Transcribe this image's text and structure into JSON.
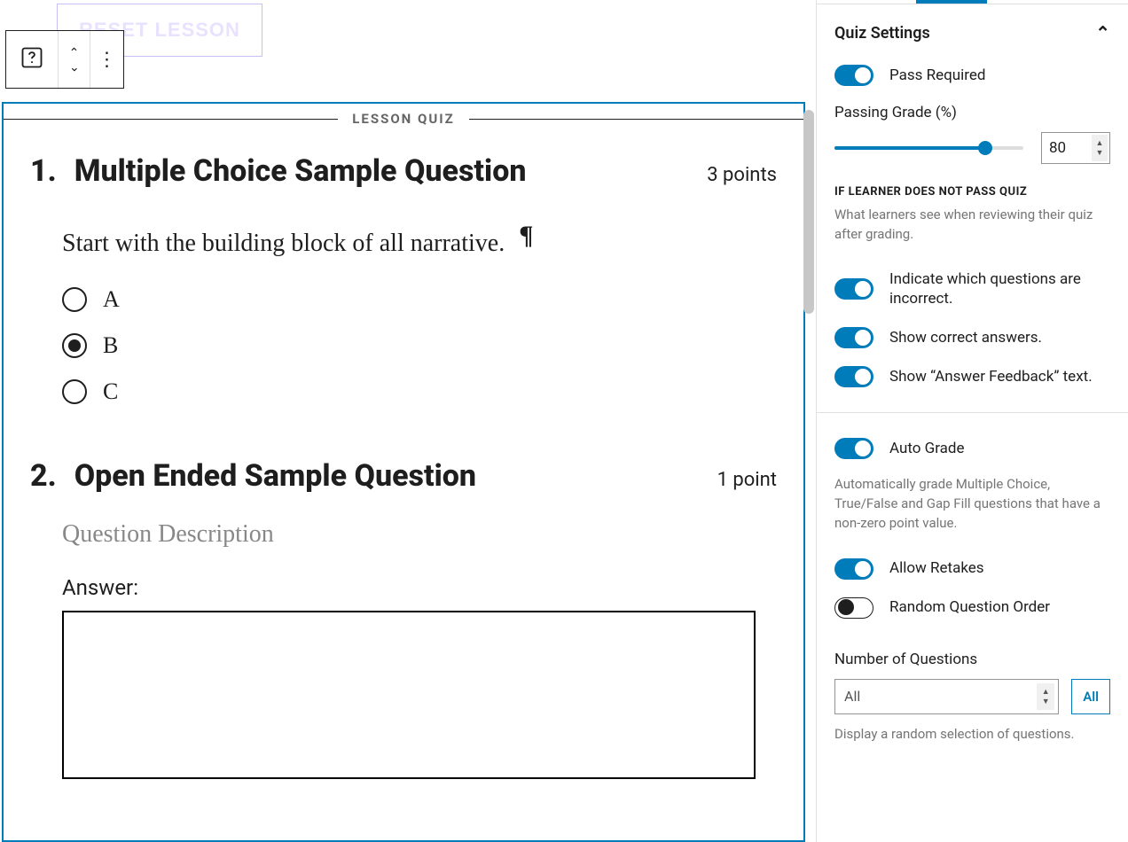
{
  "toolbar": {
    "reset_lesson_label": "RESET LESSON"
  },
  "quiz": {
    "section_label": "LESSON QUIZ",
    "questions": [
      {
        "number": "1.",
        "title": "Multiple Choice Sample Question",
        "points_label": "3 points",
        "description": "Start with the building block of all narrative.",
        "pilcrow": "¶",
        "options": [
          "A",
          "B",
          "C"
        ],
        "selected_index": 1
      },
      {
        "number": "2.",
        "title": "Open Ended Sample Question",
        "points_label": "1 point",
        "description_placeholder": "Question Description",
        "answer_label": "Answer:"
      }
    ]
  },
  "sidebar": {
    "panel_title": "Quiz Settings",
    "pass_required_label": "Pass Required",
    "passing_grade_label": "Passing Grade (%)",
    "passing_grade_value": "80",
    "passing_grade_percent": 80,
    "fail_heading": "IF LEARNER DOES NOT PASS QUIZ",
    "fail_help": "What learners see when reviewing their quiz after grading.",
    "indicate_incorrect_label": "Indicate which questions are incorrect.",
    "show_correct_label": "Show correct answers.",
    "show_feedback_label": "Show “Answer Feedback” text.",
    "auto_grade_label": "Auto Grade",
    "auto_grade_help": "Automatically grade Multiple Choice, True/False and Gap Fill questions that have a non-zero point value.",
    "allow_retakes_label": "Allow Retakes",
    "random_order_label": "Random Question Order",
    "num_questions_label": "Number of Questions",
    "num_questions_value": "All",
    "num_questions_button": "All",
    "num_questions_help": "Display a random selection of questions."
  }
}
